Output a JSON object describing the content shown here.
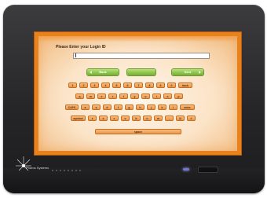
{
  "login": {
    "prompt": "Please Enter your Login ID",
    "input_value": ""
  },
  "nav": {
    "back_label": "Back",
    "middle_label": "",
    "next_label": "Next"
  },
  "keyboard": {
    "rows": [
      [
        "1",
        "2",
        "3",
        "4",
        "5",
        "6",
        "7",
        "8",
        "9",
        "0",
        "back"
      ],
      [
        "q",
        "w",
        "e",
        "r",
        "t",
        "y",
        "u",
        "i",
        "o",
        "p"
      ],
      [
        "CAPS",
        "a",
        "s",
        "d",
        "f",
        "g",
        "h",
        "j",
        "k",
        "l",
        "enter"
      ],
      [
        "symbol",
        "z",
        "x",
        "c",
        "v",
        "b",
        "n",
        "m",
        ".",
        "@",
        "#"
      ],
      [
        "space"
      ]
    ]
  },
  "device": {
    "brand": "Pharos Systems"
  },
  "colors": {
    "bezel": "#262628",
    "screen_border": "#e8821d",
    "key_fill": "#eb9647",
    "nav_green": "#8cc24a",
    "led": "#6f78c9"
  }
}
